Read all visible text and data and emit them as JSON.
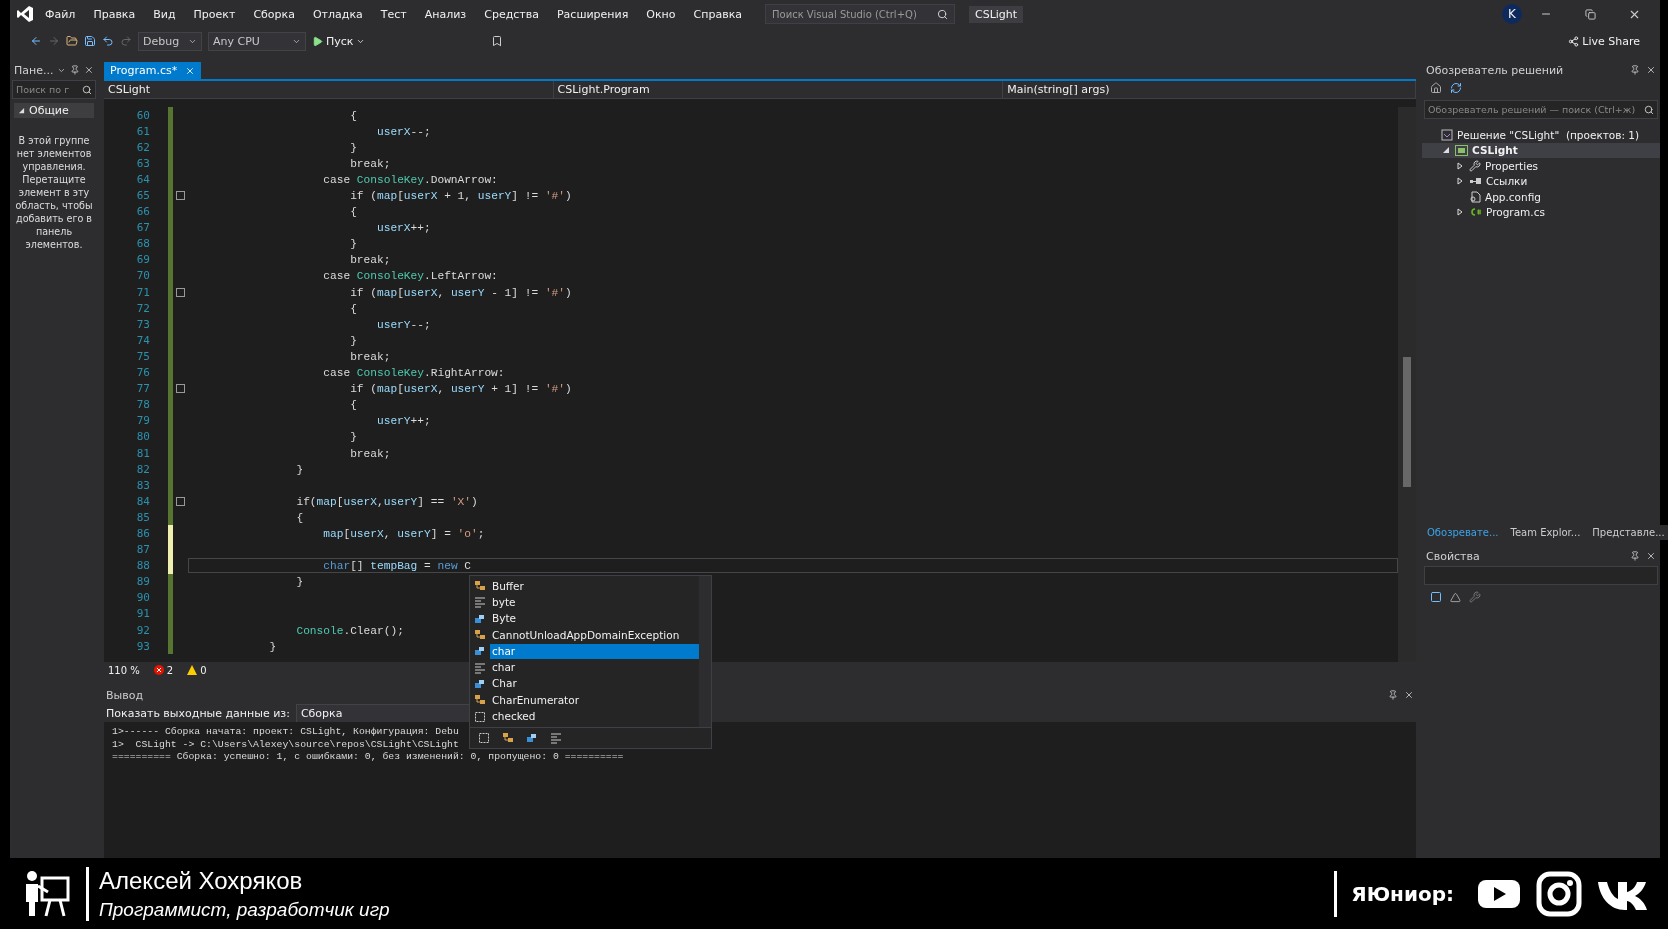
{
  "title_bar": {
    "menu": [
      "Файл",
      "Правка",
      "Вид",
      "Проект",
      "Сборка",
      "Отладка",
      "Тест",
      "Анализ",
      "Средства",
      "Расширения",
      "Окно",
      "Справка"
    ],
    "search": {
      "placeholder": "Поиск Visual Studio (Ctrl+Q)"
    },
    "solution_name": "CSLight",
    "avatar": "K"
  },
  "toolbar": {
    "configuration": "Debug",
    "platform": "Any CPU",
    "run": "Пуск",
    "live_share": "Live Share"
  },
  "toolbox": {
    "title": "Пане...",
    "search": {
      "placeholder": "Поиск по г"
    },
    "group": {
      "label": "Общие",
      "expanded": true
    },
    "message": "В этой группе нет элементов управления. Перетащите элемент в эту область, чтобы добавить его в панель элементов."
  },
  "editor": {
    "tabs": [
      {
        "label": "Program.cs*",
        "selected": true
      }
    ],
    "nav": [
      "CSLight",
      "CSLight.Program",
      "Main(string[] args)"
    ],
    "lines": [
      {
        "number": "60",
        "unsaved": false,
        "fold": false,
        "current": false,
        "segments": [
          {
            "plain": "                        {"
          }
        ]
      },
      {
        "number": "61",
        "unsaved": false,
        "fold": false,
        "current": false,
        "segments": [
          {
            "var": "                            userX"
          },
          {
            "plain": "--;"
          }
        ]
      },
      {
        "number": "62",
        "unsaved": false,
        "fold": false,
        "current": false,
        "segments": [
          {
            "plain": "                        }"
          }
        ]
      },
      {
        "number": "63",
        "unsaved": false,
        "fold": false,
        "current": false,
        "segments": [
          {
            "plain": "                        break;"
          }
        ]
      },
      {
        "number": "64",
        "unsaved": false,
        "fold": false,
        "current": false,
        "segments": [
          {
            "plain": "                    case "
          },
          {
            "type": "ConsoleKey"
          },
          {
            "plain": ".DownArrow:"
          }
        ]
      },
      {
        "number": "65",
        "unsaved": false,
        "fold": true,
        "current": false,
        "segments": [
          {
            "plain": "                        if ("
          },
          {
            "var": "map"
          },
          {
            "plain": "["
          },
          {
            "var": "userX"
          },
          {
            "plain": " + 1, "
          },
          {
            "var": "userY"
          },
          {
            "plain": "] != "
          },
          {
            "str": "'#'"
          },
          {
            "plain": ")"
          }
        ]
      },
      {
        "number": "66",
        "unsaved": false,
        "fold": false,
        "current": false,
        "segments": [
          {
            "plain": "                        {"
          }
        ]
      },
      {
        "number": "67",
        "unsaved": false,
        "fold": false,
        "current": false,
        "segments": [
          {
            "var": "                            userX"
          },
          {
            "plain": "++;"
          }
        ]
      },
      {
        "number": "68",
        "unsaved": false,
        "fold": false,
        "current": false,
        "segments": [
          {
            "plain": "                        }"
          }
        ]
      },
      {
        "number": "69",
        "unsaved": false,
        "fold": false,
        "current": false,
        "segments": [
          {
            "plain": "                        break;"
          }
        ]
      },
      {
        "number": "70",
        "unsaved": false,
        "fold": false,
        "current": false,
        "segments": [
          {
            "plain": "                    case "
          },
          {
            "type": "ConsoleKey"
          },
          {
            "plain": ".LeftArrow:"
          }
        ]
      },
      {
        "number": "71",
        "unsaved": false,
        "fold": true,
        "current": false,
        "segments": [
          {
            "plain": "                        if ("
          },
          {
            "var": "map"
          },
          {
            "plain": "["
          },
          {
            "var": "userX"
          },
          {
            "plain": ", "
          },
          {
            "var": "userY"
          },
          {
            "plain": " - 1] != "
          },
          {
            "str": "'#'"
          },
          {
            "plain": ")"
          }
        ]
      },
      {
        "number": "72",
        "unsaved": false,
        "fold": false,
        "current": false,
        "segments": [
          {
            "plain": "                        {"
          }
        ]
      },
      {
        "number": "73",
        "unsaved": false,
        "fold": false,
        "current": false,
        "segments": [
          {
            "var": "                            userY"
          },
          {
            "plain": "--;"
          }
        ]
      },
      {
        "number": "74",
        "unsaved": false,
        "fold": false,
        "current": false,
        "segments": [
          {
            "plain": "                        }"
          }
        ]
      },
      {
        "number": "75",
        "unsaved": false,
        "fold": false,
        "current": false,
        "segments": [
          {
            "plain": "                        break;"
          }
        ]
      },
      {
        "number": "76",
        "unsaved": false,
        "fold": false,
        "current": false,
        "segments": [
          {
            "plain": "                    case "
          },
          {
            "type": "ConsoleKey"
          },
          {
            "plain": ".RightArrow:"
          }
        ]
      },
      {
        "number": "77",
        "unsaved": false,
        "fold": true,
        "current": false,
        "segments": [
          {
            "plain": "                        if ("
          },
          {
            "var": "map"
          },
          {
            "plain": "["
          },
          {
            "var": "userX"
          },
          {
            "plain": ", "
          },
          {
            "var": "userY"
          },
          {
            "plain": " + 1] != "
          },
          {
            "str": "'#'"
          },
          {
            "plain": ")"
          }
        ]
      },
      {
        "number": "78",
        "unsaved": false,
        "fold": false,
        "current": false,
        "segments": [
          {
            "plain": "                        {"
          }
        ]
      },
      {
        "number": "79",
        "unsaved": false,
        "fold": false,
        "current": false,
        "segments": [
          {
            "var": "                            userY"
          },
          {
            "plain": "++;"
          }
        ]
      },
      {
        "number": "80",
        "unsaved": false,
        "fold": false,
        "current": false,
        "segments": [
          {
            "plain": "                        }"
          }
        ]
      },
      {
        "number": "81",
        "unsaved": false,
        "fold": false,
        "current": false,
        "segments": [
          {
            "plain": "                        break;"
          }
        ]
      },
      {
        "number": "82",
        "unsaved": false,
        "fold": false,
        "current": false,
        "segments": [
          {
            "plain": "                }"
          }
        ]
      },
      {
        "number": "83",
        "unsaved": false,
        "fold": false,
        "current": false
      },
      {
        "number": "84",
        "unsaved": false,
        "fold": true,
        "current": false,
        "segments": [
          {
            "plain": "                if("
          },
          {
            "var": "map"
          },
          {
            "plain": "["
          },
          {
            "var": "userX"
          },
          {
            "plain": ","
          },
          {
            "var": "userY"
          },
          {
            "plain": "] == "
          },
          {
            "str": "'X'"
          },
          {
            "plain": ")"
          }
        ]
      },
      {
        "number": "85",
        "unsaved": false,
        "fold": false,
        "current": false,
        "segments": [
          {
            "plain": "                {"
          }
        ]
      },
      {
        "number": "86",
        "unsaved": true,
        "fold": false,
        "current": false,
        "segments": [
          {
            "var": "                    map"
          },
          {
            "plain": "["
          },
          {
            "var": "userX"
          },
          {
            "plain": ", "
          },
          {
            "var": "userY"
          },
          {
            "plain": "] = "
          },
          {
            "str": "'o'"
          },
          {
            "plain": ";"
          }
        ]
      },
      {
        "number": "87",
        "unsaved": true,
        "fold": false,
        "current": false
      },
      {
        "number": "88",
        "unsaved": true,
        "fold": false,
        "current": true,
        "segments": [
          {
            "kw": "                    char"
          },
          {
            "plain": "[] "
          },
          {
            "var": "tempBag"
          },
          {
            "plain": " = "
          },
          {
            "kw": "new"
          },
          {
            "plain": " C"
          }
        ]
      },
      {
        "number": "89",
        "unsaved": false,
        "fold": false,
        "current": false,
        "segments": [
          {
            "plain": "                }"
          }
        ]
      },
      {
        "number": "90",
        "unsaved": false,
        "fold": false,
        "current": false
      },
      {
        "number": "91",
        "unsaved": false,
        "fold": false,
        "current": false
      },
      {
        "number": "92",
        "unsaved": false,
        "fold": false,
        "current": false,
        "segments": [
          {
            "type": "                Console"
          },
          {
            "plain": ".Clear();"
          }
        ]
      },
      {
        "number": "93",
        "unsaved": false,
        "fold": false,
        "current": false,
        "segments": [
          {
            "plain": "            }"
          }
        ]
      }
    ],
    "completion": [
      {
        "label": "Buffer",
        "kind": "class",
        "selected": false
      },
      {
        "label": "byte",
        "kind": "keyword",
        "selected": false
      },
      {
        "label": "Byte",
        "kind": "struct",
        "selected": false
      },
      {
        "label": "CannotUnloadAppDomainException",
        "kind": "class",
        "selected": false
      },
      {
        "label": "char",
        "kind": "struct",
        "selected": true
      },
      {
        "label": "char",
        "kind": "keyword",
        "selected": false
      },
      {
        "label": "Char",
        "kind": "struct",
        "selected": false
      },
      {
        "label": "CharEnumerator",
        "kind": "class",
        "selected": false
      },
      {
        "label": "checked",
        "kind": "snippet",
        "selected": false
      }
    ],
    "status": {
      "zoom": "110 %",
      "errors": "2",
      "warnings": "0"
    }
  },
  "output": {
    "title": "Вывод",
    "source_label": "Показать выходные данные из:",
    "source": "Сборка",
    "lines": [
      "1>------ Сборка начата: проект: CSLight, Конфигурация: Debu",
      "1>  CSLight -> C:\\Users\\Alexey\\source\\repos\\CSLight\\CSLight",
      "========== Сборка: успешно: 1, с ошибками: 0, без изменений: 0, пропущено: 0 =========="
    ]
  },
  "solution_explorer": {
    "title": "Обозреватель решений",
    "search": {
      "placeholder": "Обозреватель решений — поиск (Ctrl+ж)"
    },
    "tree": [
      {
        "label": "Решение \"CSLight\"  (проектов: 1)",
        "kind": "solution",
        "children": [
          {
            "label": "CSLight",
            "kind": "project",
            "expanded": true,
            "children": [
              {
                "label": "Properties",
                "kind": "properties",
                "expanded": false
              },
              {
                "label": "Ссылки",
                "kind": "references",
                "expanded": false
              },
              {
                "label": "App.config",
                "kind": "config"
              },
              {
                "label": "Program.cs",
                "kind": "source",
                "expanded": false
              }
            ]
          }
        ]
      }
    ],
    "tabs": [
      {
        "label": "Обозревате...",
        "selected": true
      },
      {
        "label": "Team Explor...",
        "selected": false
      },
      {
        "label": "Представле...",
        "selected": false
      }
    ]
  },
  "properties": {
    "title": "Свойства"
  },
  "lower_third": {
    "name": "Алексей Хохряков",
    "role": "Программист, разработчик игр",
    "brand": "ЯЮниор:"
  }
}
